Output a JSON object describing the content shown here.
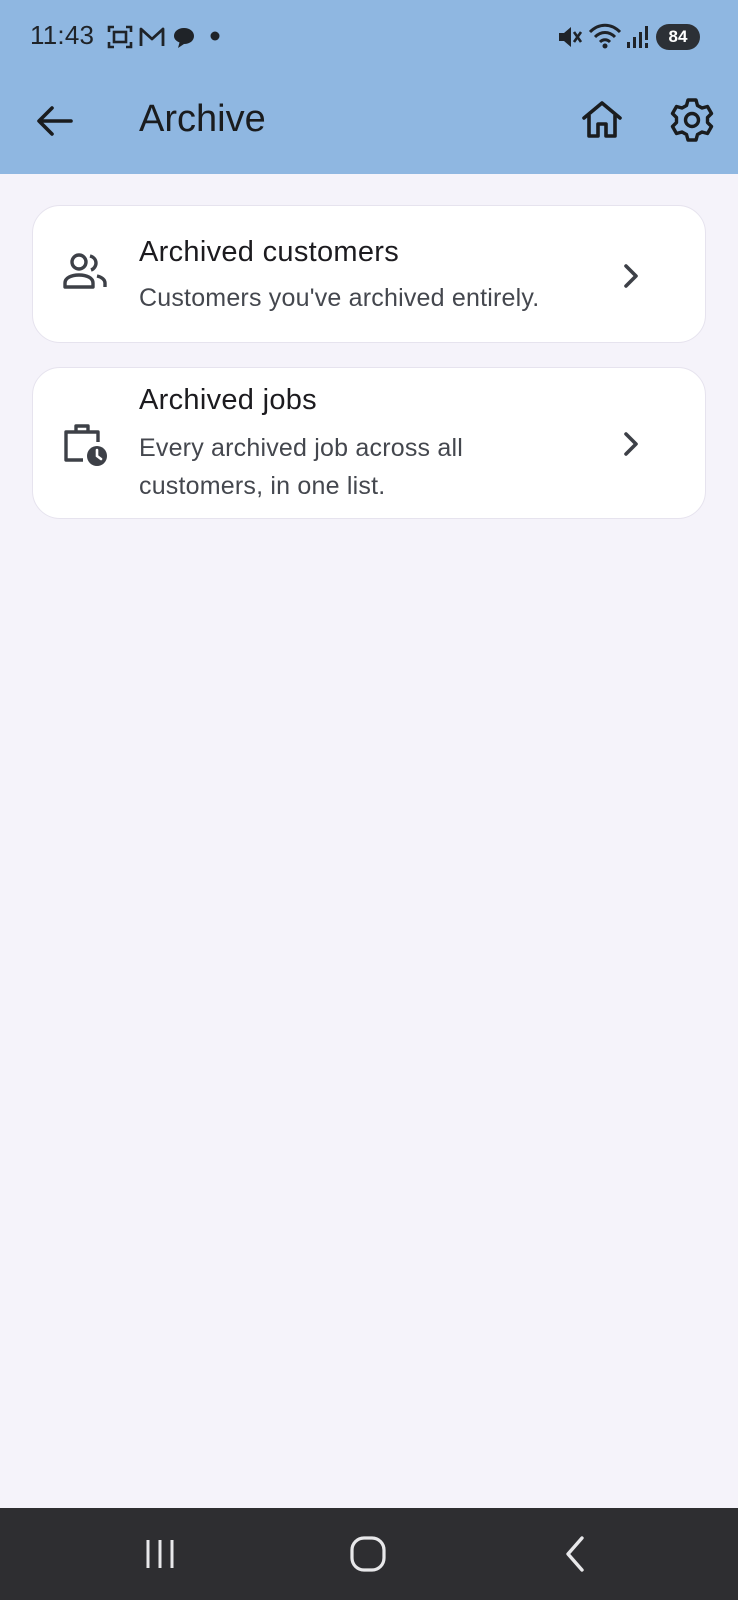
{
  "status_bar": {
    "time": "11:43",
    "battery": "84",
    "icons": [
      "screenshot-icon",
      "gmail-icon",
      "chat-icon",
      "dot-icon",
      "mute-icon",
      "wifi-icon",
      "signal-icon",
      "battery-icon"
    ]
  },
  "app_bar": {
    "title": "Archive",
    "color": "#8fb7e1",
    "back_icon": "arrow-left-icon",
    "home_icon": "home-icon",
    "settings_icon": "gear-icon"
  },
  "items": [
    {
      "title": "Archived customers",
      "subtitle": "Customers you've archived entirely.",
      "icon": "people-icon"
    },
    {
      "title": "Archived jobs",
      "subtitle": "Every archived job across all customers, in one list.",
      "icon": "briefcase-clock-icon"
    }
  ],
  "nav_bar": {
    "recents_icon": "recents-icon",
    "home_icon": "nav-home-icon",
    "back_icon": "nav-back-icon"
  }
}
